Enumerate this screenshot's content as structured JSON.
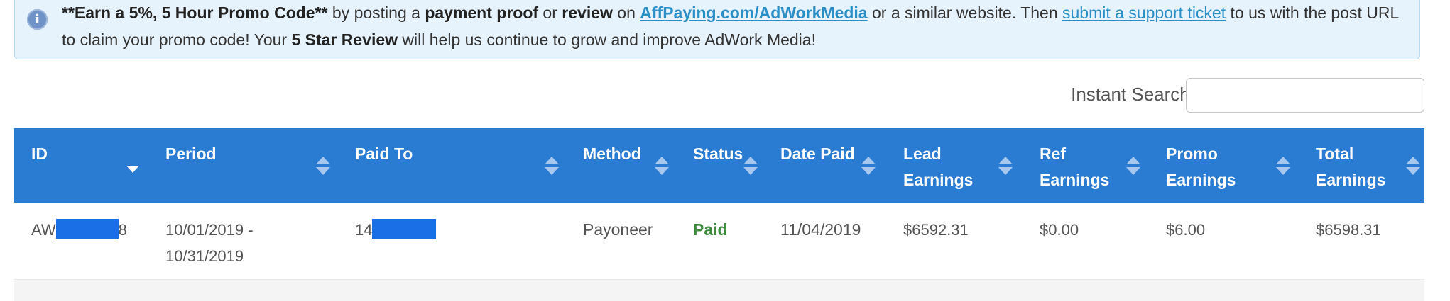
{
  "alert": {
    "prefix_bold": "**Earn a 5%, 5 Hour Promo Code**",
    "t1": " by posting a ",
    "b1": "payment proof",
    "t2": " or ",
    "b2": "review",
    "t3": " on ",
    "link1": "AffPaying.com/AdWorkMedia",
    "t4": " or a similar website. Then ",
    "link2": "submit a support ticket",
    "t5": " to us with the post URL to claim your promo code! Your ",
    "b3": "5 Star Review",
    "t6": " will help us continue to grow and improve AdWork Media!"
  },
  "search": {
    "label": "Instant Search:",
    "value": ""
  },
  "table": {
    "headers": {
      "id": "ID",
      "period": "Period",
      "paid_to": "Paid To",
      "method": "Method",
      "status": "Status",
      "date_paid": "Date Paid",
      "lead_1": "Lead",
      "lead_2": "Earnings",
      "ref_1": "Ref",
      "ref_2": "Earnings",
      "promo_1": "Promo",
      "promo_2": "Earnings",
      "total_1": "Total",
      "total_2": "Earnings"
    },
    "row": {
      "id_prefix": "AW",
      "id_suffix": "8",
      "period_1": "10/01/2019 -",
      "period_2": "10/31/2019",
      "paid_to_prefix": "14",
      "method": "Payoneer",
      "status": "Paid",
      "date_paid": "11/04/2019",
      "lead": "$6592.31",
      "ref": "$0.00",
      "promo": "$6.00",
      "total": "$6598.31"
    }
  },
  "colors": {
    "header_bg": "#2a7bd2",
    "paid_status": "#3f8a3f",
    "link": "#2a8fc7",
    "alert_bg": "#e6f3fd"
  }
}
